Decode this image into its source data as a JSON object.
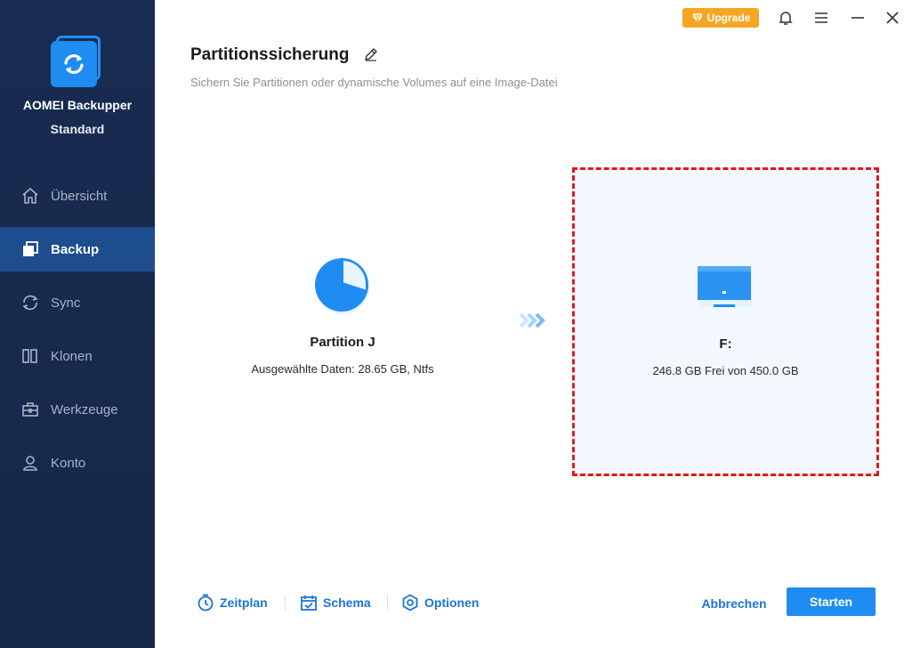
{
  "app": {
    "name": "AOMEI Backupper",
    "edition": "Standard"
  },
  "sidebar": {
    "items": [
      {
        "label": "Übersicht",
        "icon": "home-icon",
        "active": false
      },
      {
        "label": "Backup",
        "icon": "backup-icon",
        "active": true
      },
      {
        "label": "Sync",
        "icon": "sync-icon",
        "active": false
      },
      {
        "label": "Klonen",
        "icon": "clone-icon",
        "active": false
      },
      {
        "label": "Werkzeuge",
        "icon": "toolbox-icon",
        "active": false
      },
      {
        "label": "Konto",
        "icon": "user-icon",
        "active": false
      }
    ]
  },
  "topbar": {
    "upgrade_label": "Upgrade",
    "upgrade_color": "#f5a623"
  },
  "header": {
    "title": "Partitionssicherung",
    "subtitle": "Sichern Sie Partitionen oder dynamische Volumes auf eine Image-Datei"
  },
  "source": {
    "name": "Partition J",
    "detail": "Ausgewählte Daten: 28.65 GB, Ntfs"
  },
  "destination": {
    "name": "F:",
    "detail": "246.8 GB Frei von 450.0 GB",
    "highlight_color": "#e01919"
  },
  "footer": {
    "schedule_label": "Zeitplan",
    "scheme_label": "Schema",
    "options_label": "Optionen",
    "cancel_label": "Abbrechen",
    "start_label": "Starten"
  },
  "colors": {
    "sidebar_bg": "#182b50",
    "sidebar_active": "#1d4d8c",
    "accent": "#1e8cf1"
  }
}
